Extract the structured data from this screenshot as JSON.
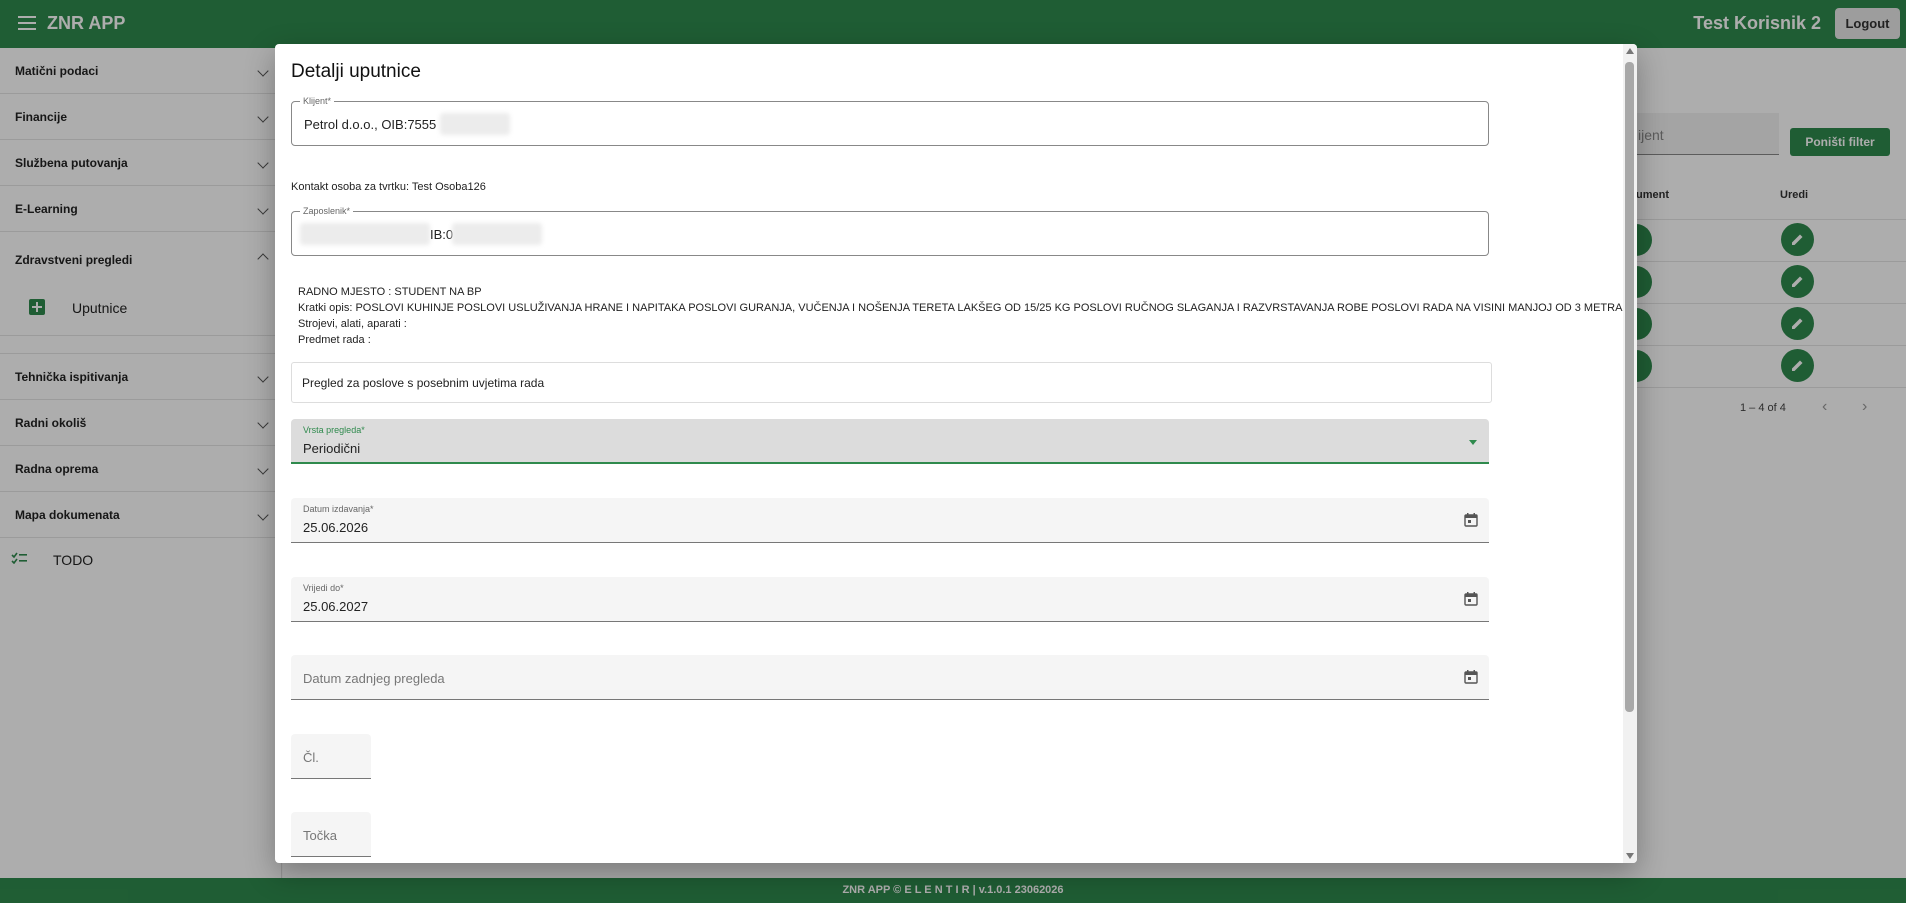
{
  "app": {
    "title": "ZNR APP",
    "user": "Test Korisnik 2",
    "logout_label": "Logout"
  },
  "sidebar": {
    "items": [
      {
        "label": "Matični podaci"
      },
      {
        "label": "Financije"
      },
      {
        "label": "Službena putovanja"
      },
      {
        "label": "E-Learning"
      },
      {
        "label": "Zdravstveni pregledi"
      },
      {
        "label": "Tehnička ispitivanja"
      },
      {
        "label": "Radni okoliš"
      },
      {
        "label": "Radna oprema"
      },
      {
        "label": "Mapa dokumenata"
      }
    ],
    "sub_item": "Uputnice",
    "todo": "TODO"
  },
  "background": {
    "filter_placeholder": "ijent",
    "filter_button": "Poništi filter",
    "col_document": "ument",
    "col_edit": "Uredi",
    "paginator": "1 – 4 of 4"
  },
  "dialog": {
    "title": "Detalji uputnice",
    "client": {
      "label": "Klijent*",
      "value": "Petrol d.o.o., OIB:7555"
    },
    "contact_line": "Kontakt osoba za tvrtku: Test Osoba126",
    "employee": {
      "label": "Zaposlenik*",
      "value": "IB:0"
    },
    "info": {
      "workplace": "RADNO MJESTO : STUDENT NA BP",
      "short_desc": "Kratki opis: POSLOVI KUHINJE POSLOVI USLUŽIVANJA HRANE I NAPITAKA POSLOVI GURANJA, VUČENJA I NOŠENJA TERETA LAKŠEG OD 15/25 KG POSLOVI RUČNOG SLAGANJA I RAZVRSTAVANJA ROBE POSLOVI RADA NA VISINI MANJOJ OD 3 METRA",
      "tools": "Strojevi, alati, aparati :",
      "subject": "Predmet rada :"
    },
    "exam_purpose": "Pregled za poslove s posebnim uvjetima rada",
    "exam_type": {
      "label": "Vrsta pregleda*",
      "value": "Periodični"
    },
    "issue_date": {
      "label": "Datum izdavanja*",
      "value": "25.06.2026"
    },
    "valid_until": {
      "label": "Vrijedi do*",
      "value": "25.06.2027"
    },
    "last_exam": {
      "placeholder": "Datum zadnjeg pregleda"
    },
    "article": {
      "placeholder": "Čl."
    },
    "point": {
      "placeholder": "Točka"
    }
  },
  "footer": {
    "text": "ZNR APP © E L E N T I R | v.1.0.1 23062026"
  },
  "colors": {
    "primary": "#2f8a4d"
  }
}
